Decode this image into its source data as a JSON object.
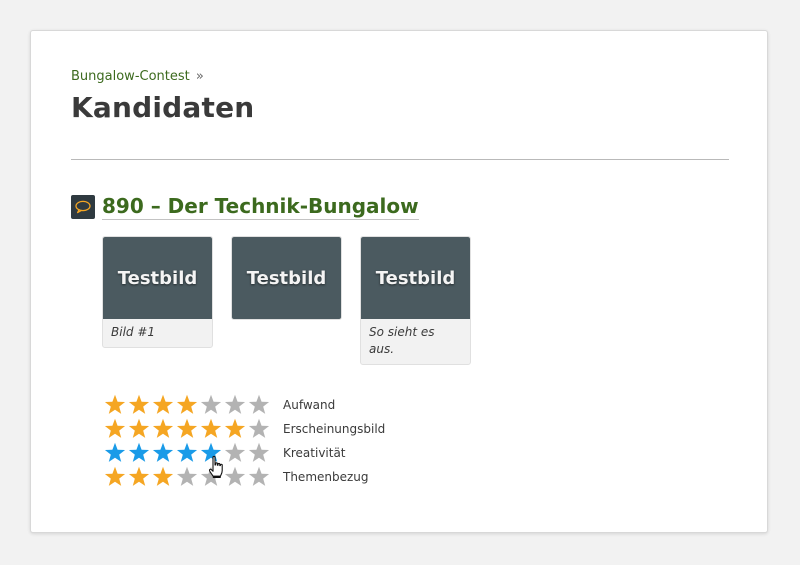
{
  "breadcrumb": {
    "link": "Bungalow-Contest",
    "separator": "»"
  },
  "page_title": "Kandidaten",
  "entry": {
    "icon": "comment-icon",
    "title": "890 – Der Technik-Bungalow",
    "gallery": [
      {
        "thumb_text": "Testbild",
        "caption": "Bild #1"
      },
      {
        "thumb_text": "Testbild",
        "caption": ""
      },
      {
        "thumb_text": "Testbild",
        "caption": "So sieht es aus."
      }
    ]
  },
  "ratings": [
    {
      "label": "Aufwand",
      "value": 4,
      "max": 7,
      "state": "normal"
    },
    {
      "label": "Erscheinungsbild",
      "value": 6,
      "max": 7,
      "state": "normal"
    },
    {
      "label": "Kreativität",
      "value": 5,
      "max": 7,
      "state": "hover"
    },
    {
      "label": "Themenbezug",
      "value": 3,
      "max": 7,
      "state": "normal"
    }
  ],
  "colors": {
    "star_filled": "#f5a623",
    "star_hover": "#1a9be8",
    "star_empty": "#b3b3b3",
    "link": "#3c6a1e"
  }
}
